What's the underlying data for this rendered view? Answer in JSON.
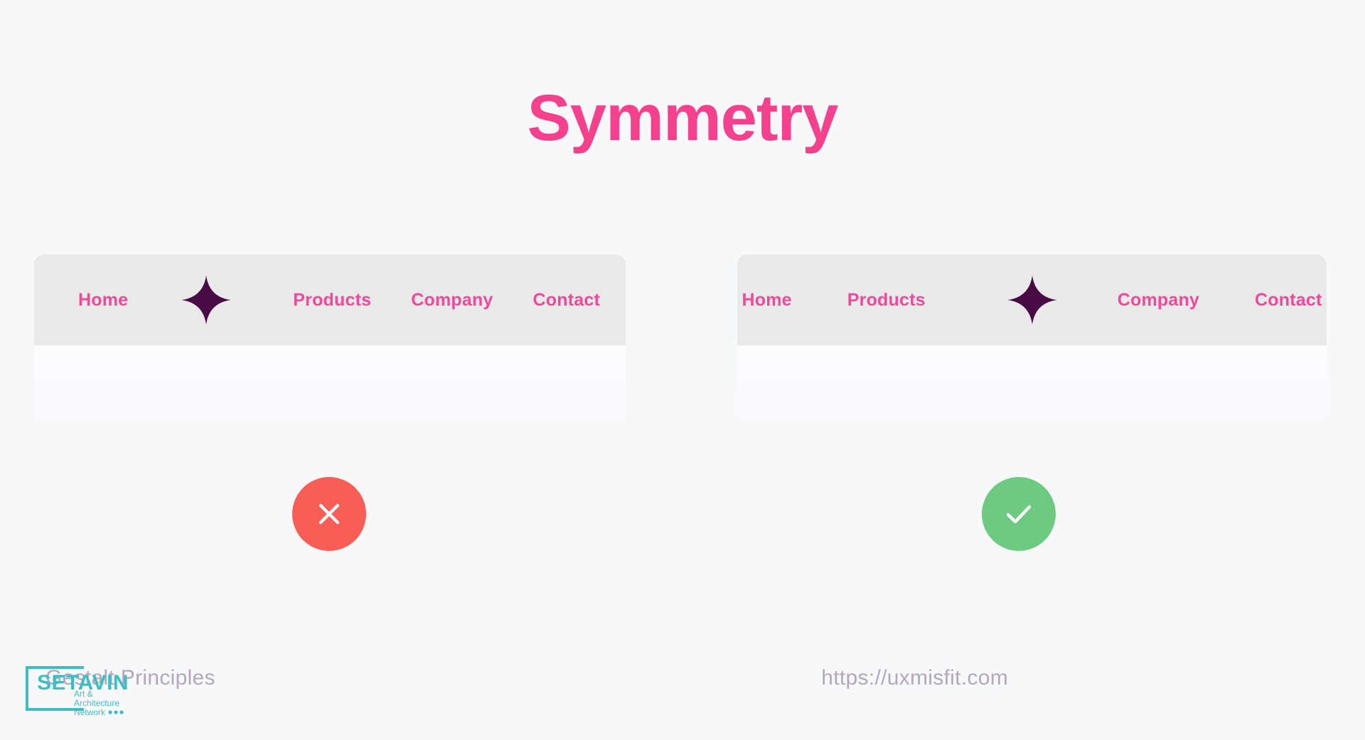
{
  "page": {
    "title": "Symmetry",
    "background_color": "#f7f8fa",
    "title_color": "#f5408d"
  },
  "examples": [
    {
      "id": "asymmetric-example",
      "verdict": "bad",
      "verdict_icon": "close-icon",
      "verdict_color": "#f95d56",
      "navbar": {
        "background_color": "#e9e9e9",
        "link_color": "#f2489a",
        "logo_icon": "four-pointed-star-icon",
        "logo_color": "#4a0b45",
        "logo_position_index": 1,
        "items": [
          {
            "label": "Home"
          },
          {
            "label": "Products"
          },
          {
            "label": "Company"
          },
          {
            "label": "Contact"
          }
        ]
      }
    },
    {
      "id": "symmetric-example",
      "verdict": "good",
      "verdict_icon": "check-icon",
      "verdict_color": "#6ccb80",
      "navbar": {
        "background_color": "#e9e9e9",
        "link_color": "#f2489a",
        "logo_icon": "four-pointed-star-icon",
        "logo_color": "#4a0b45",
        "logo_position_index": 2,
        "items": [
          {
            "label": "Home"
          },
          {
            "label": "Products"
          },
          {
            "label": "Company"
          },
          {
            "label": "Contact"
          }
        ]
      }
    }
  ],
  "footer": {
    "caption": "Gestalt Principles",
    "url": "https://uxmisfit.com",
    "text_color": "#b3a6bd"
  },
  "watermark": {
    "brand": "SETAVIN",
    "line1": "Art &",
    "line2": "Architecture",
    "line3": "Network",
    "dots": "•••",
    "color": "#3cbfc4"
  }
}
